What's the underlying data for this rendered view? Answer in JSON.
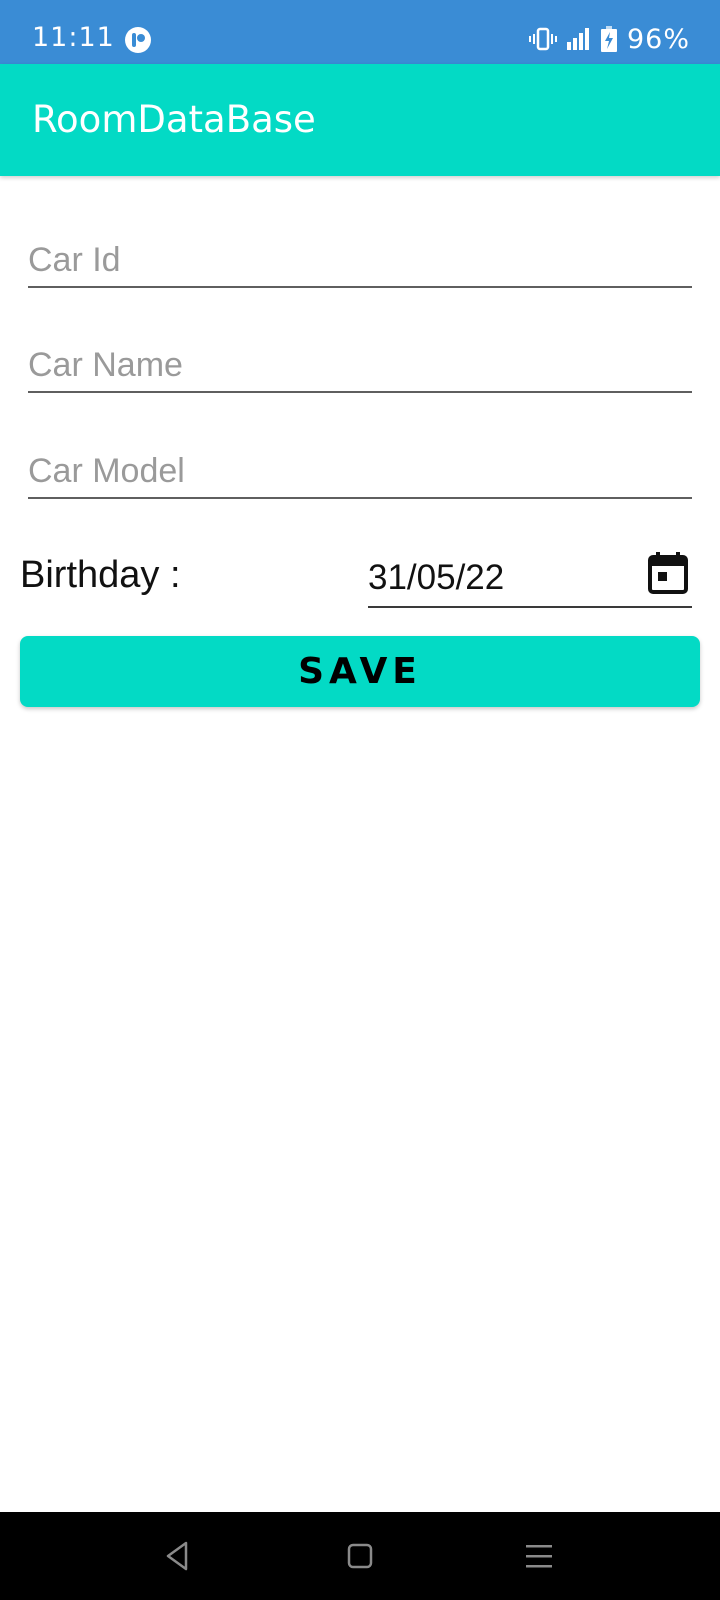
{
  "status_bar": {
    "time": "11:11",
    "battery": "96%",
    "color": "#3a8cd5",
    "icons": [
      "app-notification-icon",
      "vibrate-icon",
      "signal-icon",
      "battery-charging-icon"
    ]
  },
  "app_bar": {
    "title": "RoomDataBase",
    "color": "#03dac5"
  },
  "form": {
    "car_id_placeholder": "Car Id",
    "car_name_placeholder": "Car Name",
    "car_model_placeholder": "Car Model",
    "birthday_label": "Birthday :",
    "birthday_value": "31/05/22",
    "calendar_icon": "calendar-icon",
    "save_label": "SAVE"
  },
  "nav_bar": {
    "icons": [
      "back-icon",
      "home-icon",
      "recents-icon"
    ]
  }
}
